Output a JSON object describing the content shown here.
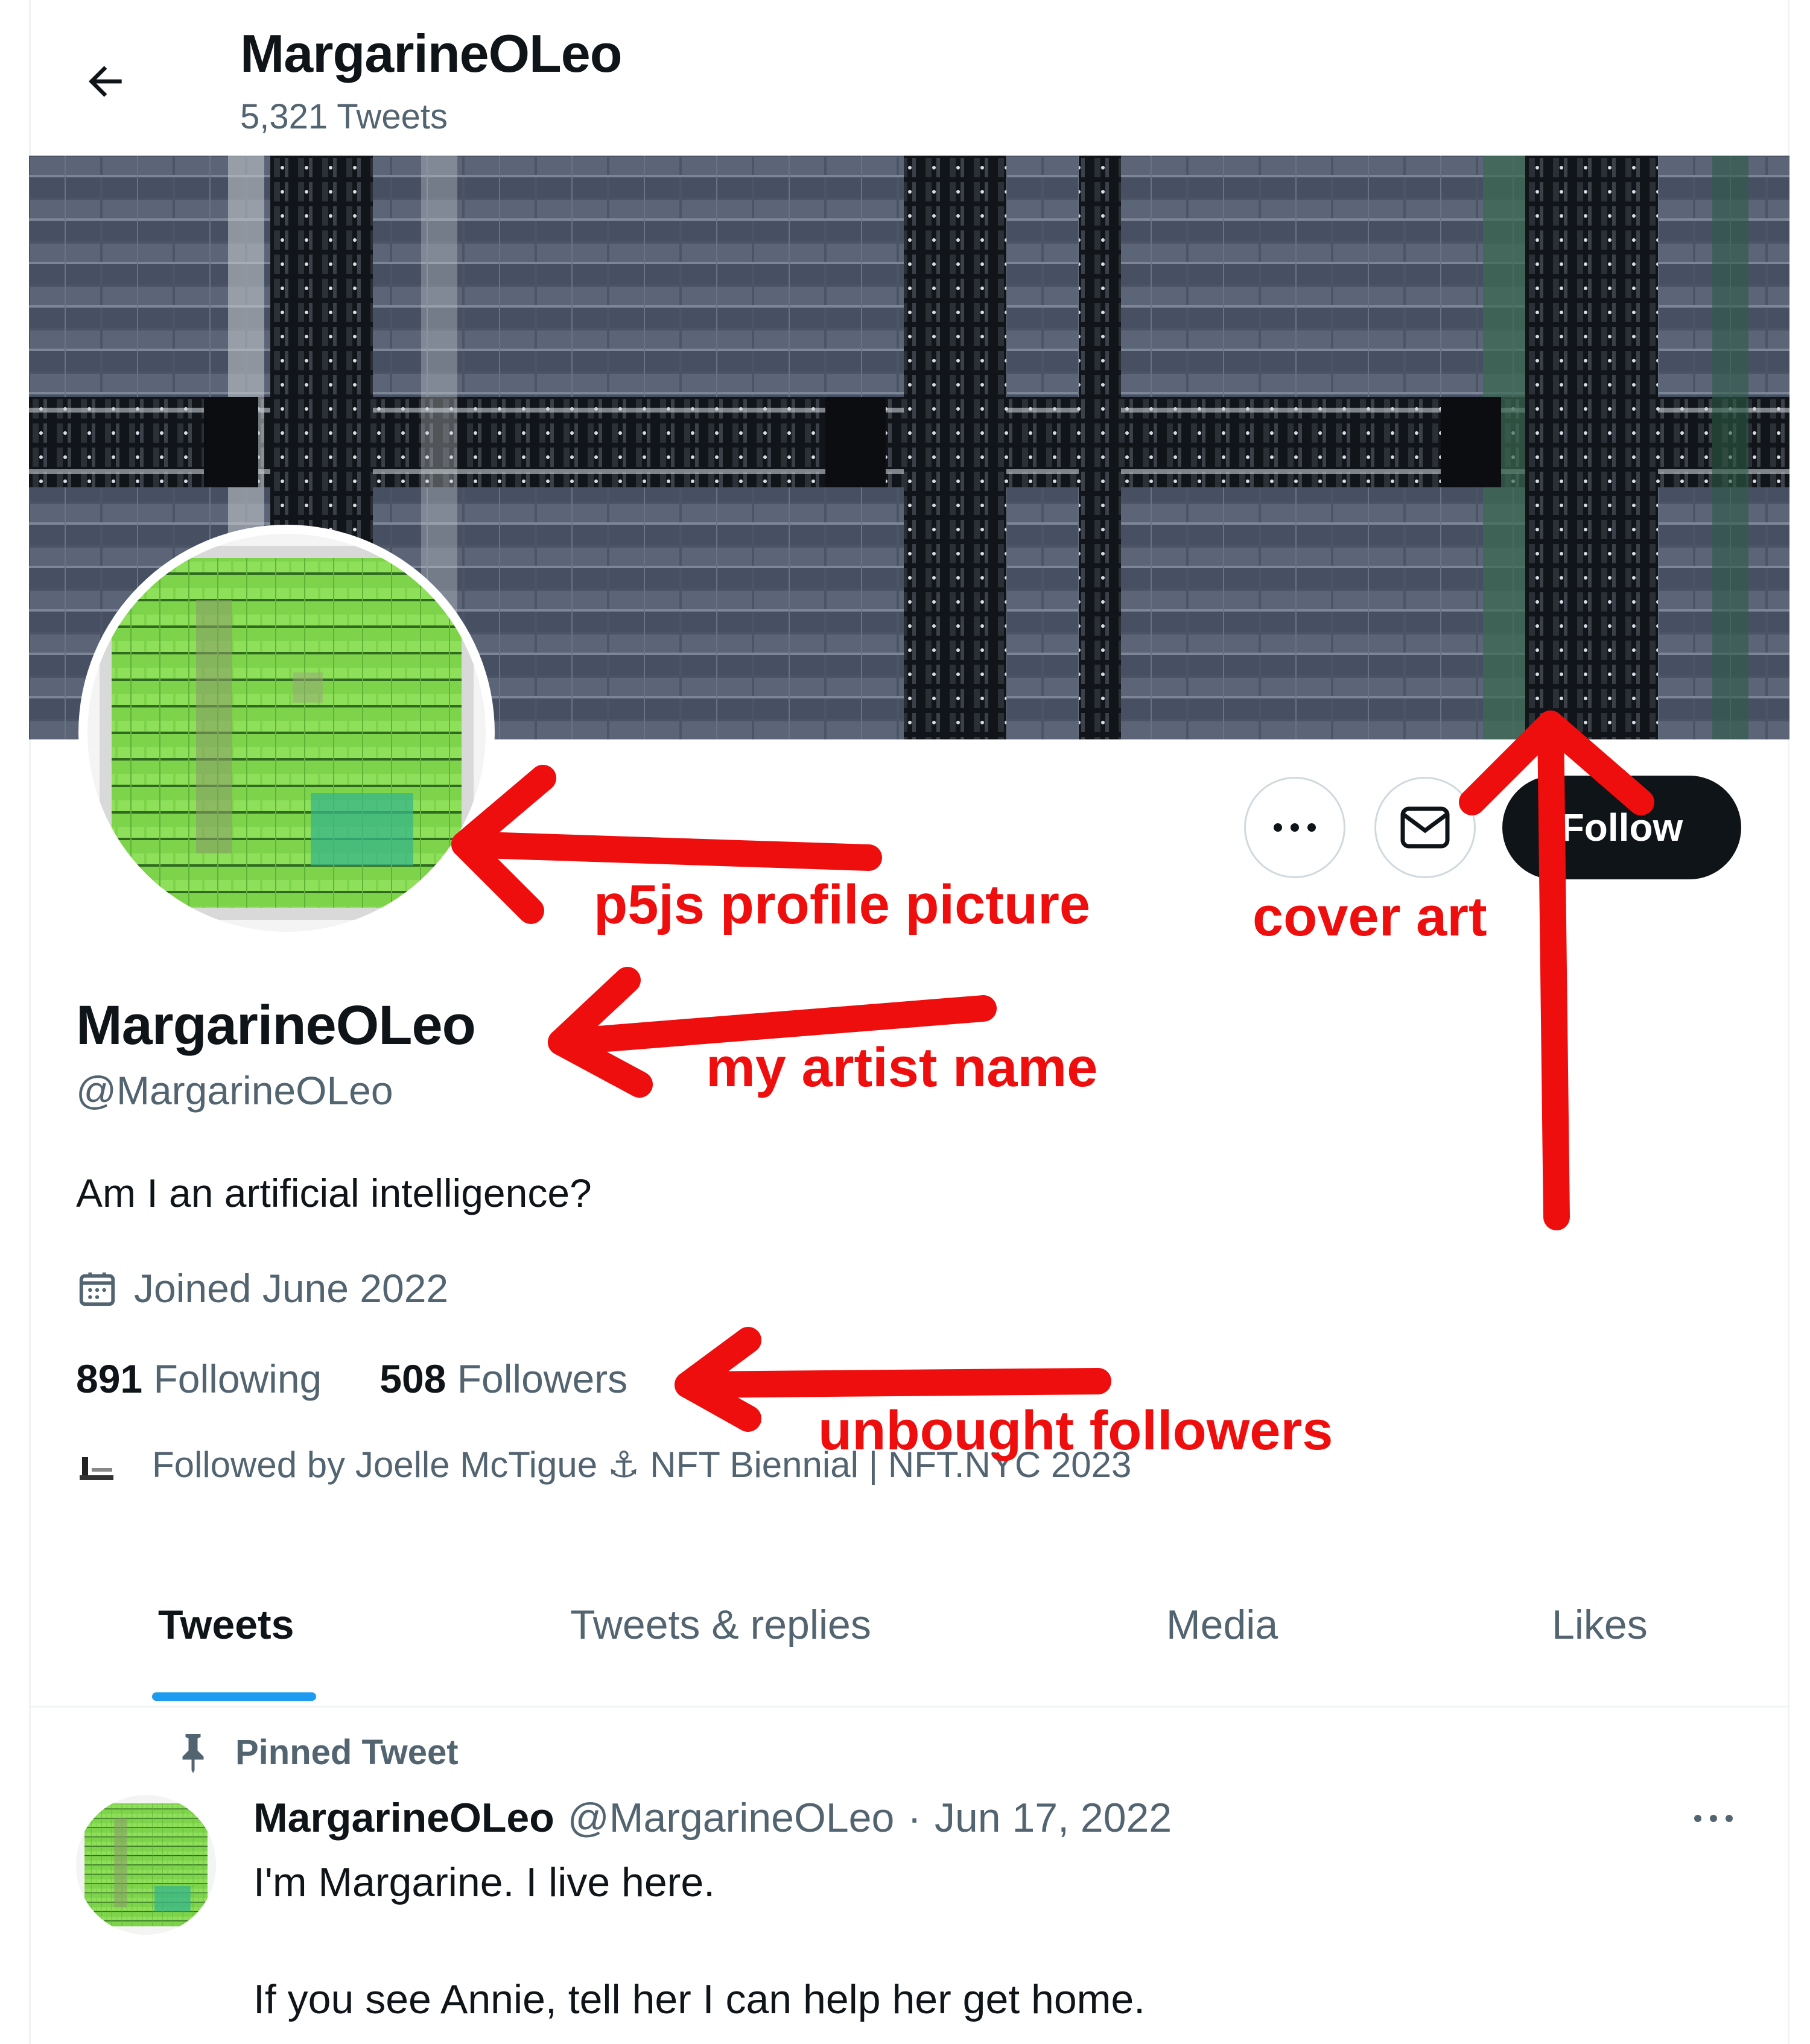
{
  "header": {
    "title": "MargarineOLeo",
    "tweet_count": "5,321 Tweets"
  },
  "actions": {
    "follow_label": "Follow"
  },
  "profile": {
    "display_name": "MargarineOLeo",
    "handle": "@MargarineOLeo",
    "bio": "Am I an artificial intelligence?",
    "joined": "Joined June 2022",
    "following_count": "891",
    "following_label": "Following",
    "followers_count": "508",
    "followers_label": "Followers",
    "followed_by": "Followed by Joelle McTigue ⚓ NFT Biennial | NFT.NYC 2023"
  },
  "tabs": [
    {
      "label": "Tweets",
      "active": true
    },
    {
      "label": "Tweets & replies",
      "active": false
    },
    {
      "label": "Media",
      "active": false
    },
    {
      "label": "Likes",
      "active": false
    }
  ],
  "pinned_tweet": {
    "pinned_label": "Pinned Tweet",
    "name": "MargarineOLeo",
    "handle": "@MargarineOLeo",
    "separator": "·",
    "date": "Jun 17, 2022",
    "line1": "I'm Margarine. I live here.",
    "line2": "If you see Annie, tell her I can help her get home."
  },
  "annotations": {
    "profile_picture": "p5js profile picture",
    "cover_art": "cover art",
    "artist_name": "my artist name",
    "followers": "unbought followers"
  },
  "colors": {
    "annotation_red": "#ee0e0e",
    "tab_underline": "#1d9bf0",
    "follow_button": "#0f1419",
    "secondary_text": "#536471"
  },
  "icons": {
    "back": "back-arrow-icon",
    "more": "more-dots-icon",
    "message": "envelope-icon",
    "calendar": "calendar-icon",
    "pin": "pin-icon"
  }
}
